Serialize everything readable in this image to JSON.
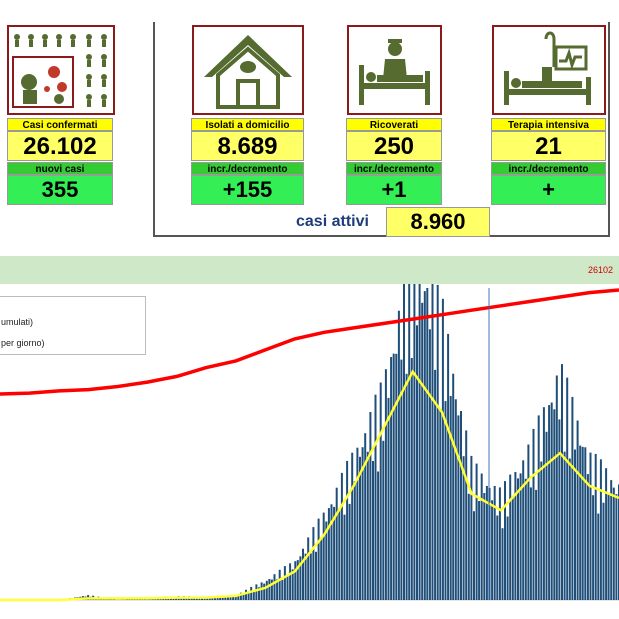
{
  "cards": {
    "casi_confermati": {
      "label": "Casi confermati",
      "value": "26.102",
      "delta_label": "nuovi casi",
      "delta": "355"
    },
    "isolati": {
      "label": "Isolati a domicilio",
      "value": "8.689",
      "delta_label": "incr./decremento",
      "delta": "+155"
    },
    "ricoverati": {
      "label": "Ricoverati",
      "value": "250",
      "delta_label": "incr./decremento",
      "delta": "+1"
    },
    "terapia": {
      "label": "Terapia intensiva",
      "value": "21",
      "delta_label": "incr./decremento",
      "delta": "+"
    }
  },
  "attivi": {
    "label": "casi attivi",
    "value": "8.960"
  },
  "icons": [
    "crowd-virus-icon",
    "house-icon",
    "hospital-bed-icon",
    "icu-bed-icon"
  ],
  "colors": {
    "cumulative_line": "#ff0000",
    "daily_bars": "#1f4e79",
    "moving_avg": "#ffff33",
    "header_band": "#cfe8c8"
  },
  "chart_data": {
    "type": "bar",
    "legend": [
      "umulati)",
      "per giorno)"
    ],
    "peak_annotation": "26102",
    "series": [
      {
        "kind": "line",
        "values": [
          2500,
          2700,
          3200,
          3500,
          4200,
          5200,
          6500,
          8500,
          10000,
          12500,
          15000,
          16500,
          17500,
          18500,
          19500,
          20500,
          21500,
          22500,
          23500,
          24500,
          25500,
          26102
        ]
      },
      {
        "kind": "bar",
        "values": [
          0,
          0,
          0,
          5,
          0,
          2,
          4,
          3,
          5,
          20,
          40,
          90,
          150,
          220,
          370,
          300,
          140,
          110,
          160,
          240,
          150,
          120
        ]
      },
      {
        "kind": "line",
        "values": [
          0,
          0,
          0,
          2,
          2,
          2,
          3,
          3,
          5,
          15,
          35,
          80,
          140,
          210,
          280,
          230,
          130,
          110,
          150,
          180,
          140,
          125
        ]
      }
    ]
  }
}
